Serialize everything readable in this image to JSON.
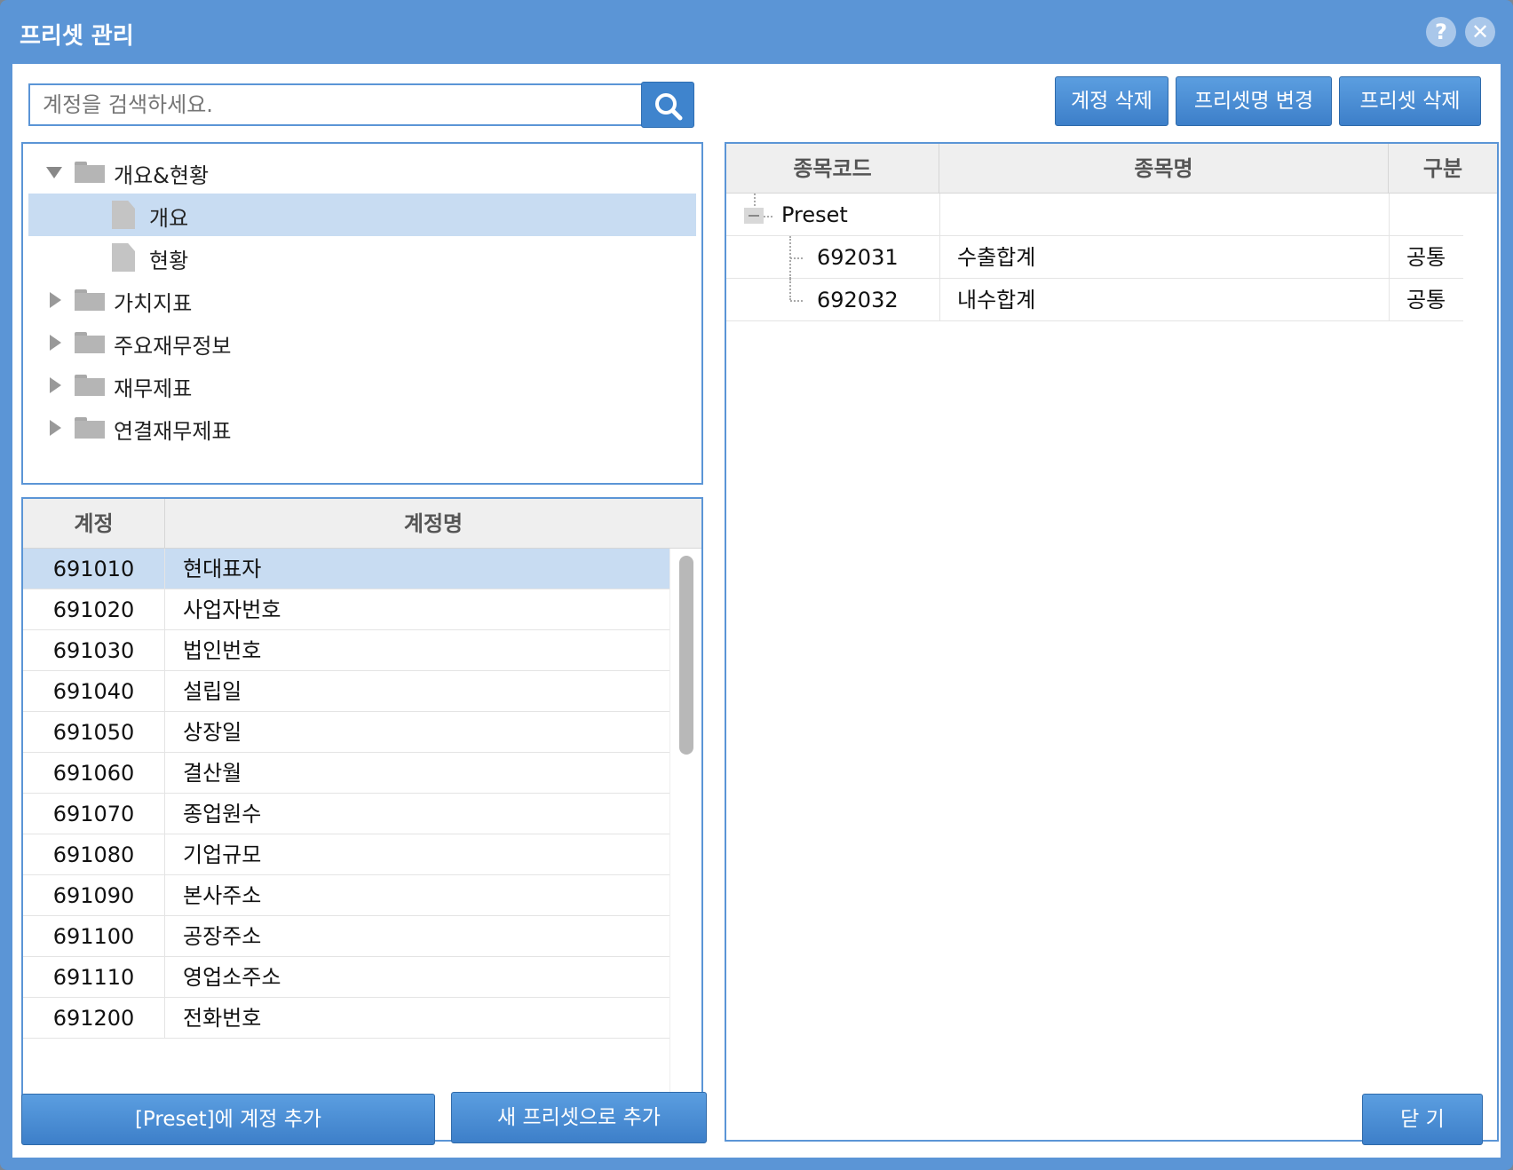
{
  "window": {
    "title": "프리셋 관리",
    "help_icon": "?",
    "close_icon": "✕"
  },
  "search": {
    "placeholder": "계정을 검색하세요."
  },
  "toolbar": {
    "delete_account": "계정 삭제",
    "rename_preset": "프리셋명 변경",
    "delete_preset": "프리셋 삭제"
  },
  "tree": {
    "items": [
      {
        "label": "개요&현황",
        "type": "folder",
        "expanded": true
      },
      {
        "label": "개요",
        "type": "doc",
        "selected": true
      },
      {
        "label": "현황",
        "type": "doc"
      },
      {
        "label": "가치지표",
        "type": "folder"
      },
      {
        "label": "주요재무정보",
        "type": "folder"
      },
      {
        "label": "재무제표",
        "type": "folder"
      },
      {
        "label": "연결재무제표",
        "type": "folder"
      }
    ]
  },
  "accounts": {
    "headers": {
      "code": "계정",
      "name": "계정명"
    },
    "rows": [
      {
        "code": "691010",
        "name": "현대표자"
      },
      {
        "code": "691020",
        "name": "사업자번호"
      },
      {
        "code": "691030",
        "name": "법인번호"
      },
      {
        "code": "691040",
        "name": "설립일"
      },
      {
        "code": "691050",
        "name": "상장일"
      },
      {
        "code": "691060",
        "name": "결산월"
      },
      {
        "code": "691070",
        "name": "종업원수"
      },
      {
        "code": "691080",
        "name": "기업규모"
      },
      {
        "code": "691090",
        "name": "본사주소"
      },
      {
        "code": "691100",
        "name": "공장주소"
      },
      {
        "code": "691110",
        "name": "영업소주소"
      },
      {
        "code": "691200",
        "name": "전화번호"
      }
    ]
  },
  "preset": {
    "headers": {
      "code": "종목코드",
      "name": "종목명",
      "type": "구분"
    },
    "group": "Preset",
    "rows": [
      {
        "code": "692031",
        "name": "수출합계",
        "type": "공통"
      },
      {
        "code": "692032",
        "name": "내수합계",
        "type": "공통"
      }
    ]
  },
  "footer": {
    "add_to_preset": "[Preset]에 계정 추가",
    "add_new_preset": "새 프리셋으로 추가",
    "close": "닫 기"
  }
}
